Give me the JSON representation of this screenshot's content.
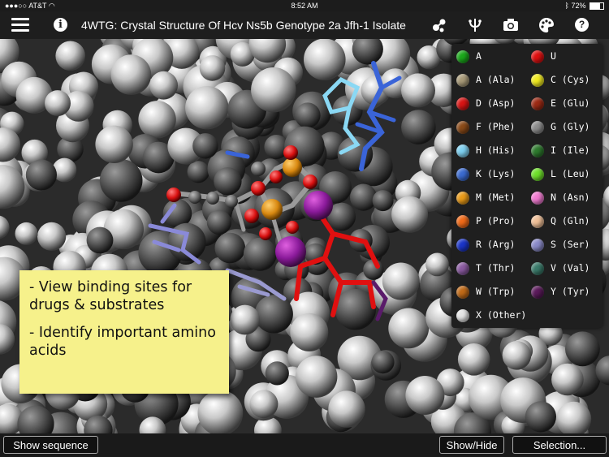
{
  "status": {
    "carrier": "AT&T",
    "time": "8:52 AM",
    "battery": "72%",
    "battery_fraction": 0.72
  },
  "toolbar": {
    "title": "4WTG: Crystal Structure Of Hcv Ns5b Genotype 2a Jfh-1 Isolate..."
  },
  "note": {
    "line1": "- View binding sites for drugs & substrates",
    "line2": "- Identify important amino acids"
  },
  "legend": {
    "items": [
      {
        "label": "A",
        "color": "#1aa81a"
      },
      {
        "label": "U",
        "color": "#e01010"
      },
      {
        "label": "A (Ala)",
        "color": "#a89a78"
      },
      {
        "label": "C (Cys)",
        "color": "#f0ea20"
      },
      {
        "label": "D (Asp)",
        "color": "#d81414"
      },
      {
        "label": "E (Glu)",
        "color": "#9c2a14"
      },
      {
        "label": "F (Phe)",
        "color": "#8a4a18"
      },
      {
        "label": "G (Gly)",
        "color": "#8c8c8c"
      },
      {
        "label": "H (His)",
        "color": "#7ed0f0"
      },
      {
        "label": "I (Ile)",
        "color": "#2e7a2e"
      },
      {
        "label": "K (Lys)",
        "color": "#3a6ad0"
      },
      {
        "label": "L (Leu)",
        "color": "#6ee02a"
      },
      {
        "label": "M (Met)",
        "color": "#e89a18"
      },
      {
        "label": "N (Asn)",
        "color": "#f07ad0"
      },
      {
        "label": "P (Pro)",
        "color": "#f06a18"
      },
      {
        "label": "Q (Gln)",
        "color": "#f0c098"
      },
      {
        "label": "R (Arg)",
        "color": "#1a34c8"
      },
      {
        "label": "S (Ser)",
        "color": "#8a8ac8"
      },
      {
        "label": "T (Thr)",
        "color": "#8a5aa0"
      },
      {
        "label": "V (Val)",
        "color": "#3a7a6a"
      },
      {
        "label": "W (Trp)",
        "color": "#c06a18"
      },
      {
        "label": "Y (Tyr)",
        "color": "#5a1a5a"
      },
      {
        "label": "X (Other)",
        "color": "#e4e4e4"
      }
    ]
  },
  "bottom": {
    "show_sequence": "Show sequence",
    "show_hide": "Show/Hide",
    "selection": "Selection..."
  }
}
